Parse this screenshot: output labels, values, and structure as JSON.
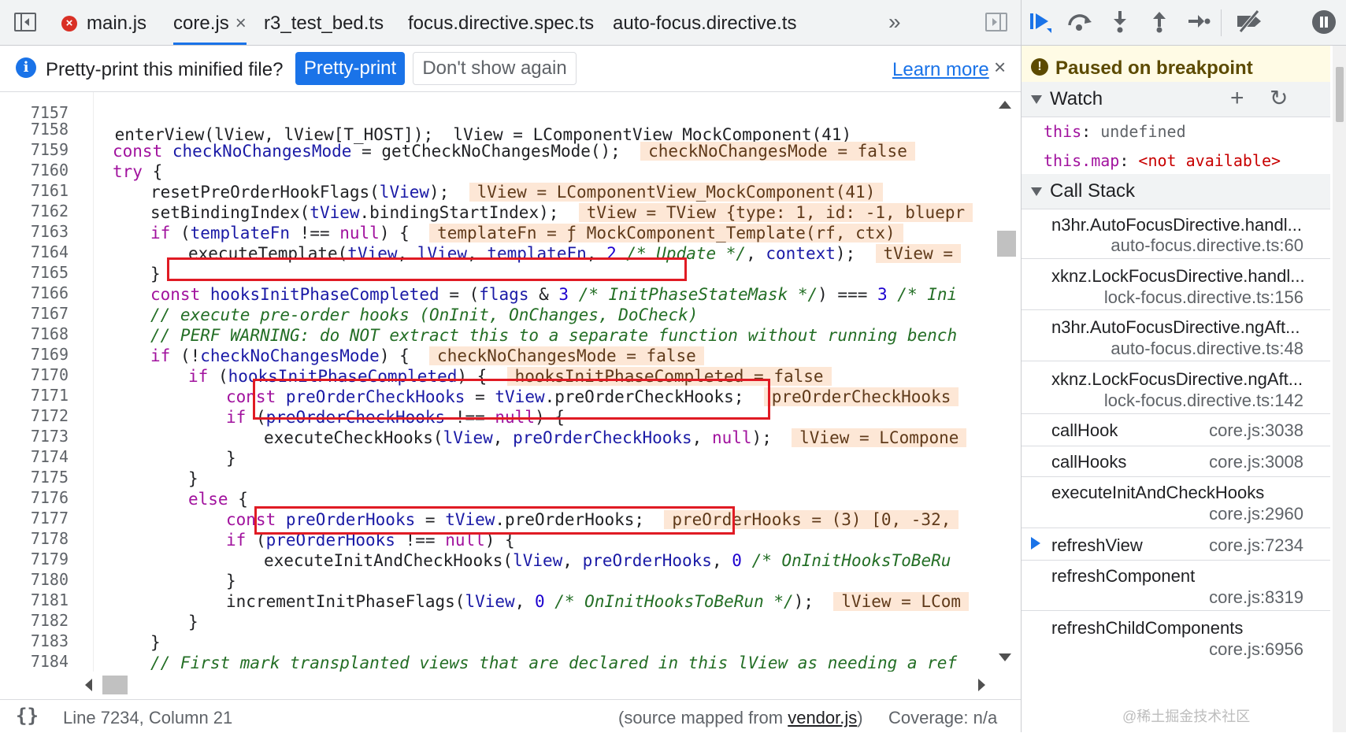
{
  "tabs": {
    "items": [
      {
        "label": "main.js",
        "error": "×"
      },
      {
        "label": "core.js",
        "close": "×"
      },
      {
        "label": "r3_test_bed.ts"
      },
      {
        "label": "focus.directive.spec.ts"
      },
      {
        "label": "auto-focus.directive.ts"
      }
    ],
    "more": "»"
  },
  "infobar": {
    "icon": "i",
    "message": "Pretty-print this minified file?",
    "primary_button": "Pretty-print",
    "secondary_button": "Don't show again",
    "learn_more": "Learn more",
    "close": "×"
  },
  "editor": {
    "lines": [
      {
        "n": "7157",
        "code": "    enterView(lView, lView[T_HOST]);  lView = LComponentView_MockComponent(41)"
      },
      {
        "n": "7158"
      },
      {
        "n": "7159"
      },
      {
        "n": "7160"
      },
      {
        "n": "7161"
      },
      {
        "n": "7162"
      },
      {
        "n": "7163"
      },
      {
        "n": "7164"
      },
      {
        "n": "7165"
      },
      {
        "n": "7166"
      },
      {
        "n": "7167"
      },
      {
        "n": "7168"
      },
      {
        "n": "7169"
      },
      {
        "n": "7170"
      },
      {
        "n": "7171"
      },
      {
        "n": "7172"
      },
      {
        "n": "7173"
      },
      {
        "n": "7174"
      },
      {
        "n": "7175"
      },
      {
        "n": "7176"
      },
      {
        "n": "7177"
      },
      {
        "n": "7178"
      },
      {
        "n": "7179"
      },
      {
        "n": "7180"
      },
      {
        "n": "7181"
      },
      {
        "n": "7182"
      },
      {
        "n": "7183"
      },
      {
        "n": "7184"
      }
    ],
    "tokens": {
      "l7158": {
        "kw": "const",
        "var": "checkNoChangesMode",
        "rest": " = getCheckNoChangesMode();",
        "val": "checkNoChangesMode = false"
      },
      "l7159": {
        "kw": "try",
        "rest": " {"
      },
      "l7160": {
        "code": "resetPreOrderHookFlags(",
        "var": "lView",
        "rest": ");",
        "val": "lView = LComponentView_MockComponent(41)"
      },
      "l7161": {
        "code": "setBindingIndex(",
        "var": "tView",
        "rest": ".bindingStartIndex);",
        "val": "tView = TView {type: 1, id: -1, bluepr"
      },
      "l7162": {
        "kw": "if",
        "a": " (",
        "var": "templateFn",
        "b": " !== ",
        "kw2": "null",
        "c": ") {",
        "val": "templateFn = ƒ MockComponent_Template(rf, ctx)"
      },
      "l7163": {
        "code": "executeTemplate(",
        "v1": "tView",
        "s1": ", ",
        "v2": "lView",
        "s2": ", ",
        "v3": "templateFn",
        "s3": ", ",
        "num": "2",
        "cm": " /* Update */",
        "s4": ", ",
        "v4": "context",
        "s5": ");",
        "val": "tView ="
      },
      "l7164": {
        "code": "}"
      },
      "l7165": {
        "kw": "const",
        "var": "hooksInitPhaseCompleted",
        "a": " = (",
        "v2": "flags",
        "b": " & ",
        "num": "3",
        "cm": " /* InitPhaseStateMask */",
        "c": ") === ",
        "num2": "3",
        "cm2": " /* Ini"
      },
      "l7166": {
        "cm": "// execute pre-order hooks (OnInit, OnChanges, DoCheck)"
      },
      "l7167": {
        "cm": "// PERF WARNING: do NOT extract this to a separate function without running bench"
      },
      "l7168": {
        "kw": "if",
        "a": " (!",
        "var": "checkNoChangesMode",
        "b": ") {",
        "val": "checkNoChangesMode = false"
      },
      "l7169": {
        "kw": "if",
        "a": " (",
        "var": "hooksInitPhaseCompleted",
        "b": ") {",
        "val": "hooksInitPhaseCompleted = false"
      },
      "l7170": {
        "kw": "const",
        "var": "preOrderCheckHooks",
        "a": " = ",
        "v2": "tView",
        "b": ".preOrderCheckHooks;",
        "val": "preOrderCheckHooks"
      },
      "l7171": {
        "kw": "if",
        "a": " (",
        "var": "preOrderCheckHooks",
        "b": " !== ",
        "kw2": "null",
        "c": ") {"
      },
      "l7172": {
        "code": "executeCheckHooks(",
        "v1": "lView",
        "s1": ", ",
        "v2": "preOrderCheckHooks",
        "s2": ", ",
        "kw": "null",
        "s3": ");",
        "val": "lView = LCompone"
      },
      "l7173": {
        "code": "}"
      },
      "l7174": {
        "code": "}"
      },
      "l7175": {
        "kw": "else",
        "rest": " {"
      },
      "l7176": {
        "kw": "const",
        "var": "preOrderHooks",
        "a": " = ",
        "v2": "tView",
        "b": ".preOrderHooks;",
        "val": "preOrderHooks = (3) [0, -32,"
      },
      "l7177": {
        "kw": "if",
        "a": " (",
        "var": "preOrderHooks",
        "b": " !== ",
        "kw2": "null",
        "c": ") {"
      },
      "l7178": {
        "code": "executeInitAndCheckHooks(",
        "v1": "lView",
        "s1": ", ",
        "v2": "preOrderHooks",
        "s2": ", ",
        "num": "0",
        "cm": " /* OnInitHooksToBeRu"
      },
      "l7179": {
        "code": "}"
      },
      "l7180": {
        "code": "incrementInitPhaseFlags(",
        "v1": "lView",
        "s1": ", ",
        "num": "0",
        "cm": " /* OnInitHooksToBeRun */",
        "s2": ");",
        "val": "lView = LCom"
      },
      "l7181": {
        "code": "}"
      },
      "l7182": {
        "code": "}"
      },
      "l7183": {
        "cm": "// First mark transplanted views that are declared in this lView as needing a ref"
      }
    }
  },
  "status": {
    "braces": "{}",
    "position": "Line 7234, Column 21",
    "source_prefix": "(source mapped from ",
    "source_file": "vendor.js",
    "source_suffix": ")",
    "coverage": "Coverage: n/a"
  },
  "debugger": {
    "paused_icon": "!",
    "paused_text": "Paused on breakpoint",
    "watch_title": "Watch",
    "watch_add": "+",
    "watch_refresh": "↻",
    "watch": [
      {
        "name": "this",
        "sep": ": ",
        "value": "undefined"
      },
      {
        "name": "this.map",
        "sep": ": ",
        "value": "<not available>"
      }
    ],
    "callstack_title": "Call Stack",
    "frames": [
      {
        "name": "n3hr.AutoFocusDirective.handl...",
        "loc": "auto-focus.directive.ts:60"
      },
      {
        "name": "xknz.LockFocusDirective.handl...",
        "loc": "lock-focus.directive.ts:156"
      },
      {
        "name": "n3hr.AutoFocusDirective.ngAft...",
        "loc": "auto-focus.directive.ts:48"
      },
      {
        "name": "xknz.LockFocusDirective.ngAft...",
        "loc": "lock-focus.directive.ts:142"
      },
      {
        "name": "callHook",
        "loc": "core.js:3038"
      },
      {
        "name": "callHooks",
        "loc": "core.js:3008"
      },
      {
        "name": "executeInitAndCheckHooks",
        "loc": "core.js:2960"
      },
      {
        "name": "refreshView",
        "loc": "core.js:7234"
      },
      {
        "name": "refreshComponent",
        "loc": "core.js:8319"
      },
      {
        "name": "refreshChildComponents",
        "loc": "core.js:6956"
      }
    ],
    "watermark": "@稀土掘金技术社区"
  }
}
